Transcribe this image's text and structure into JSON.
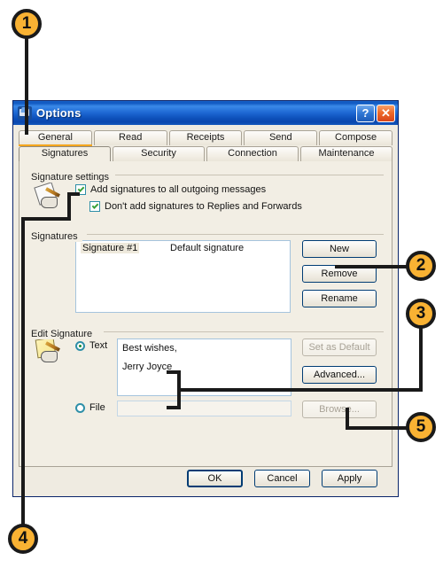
{
  "window": {
    "title": "Options",
    "icon": "mail-options-icon",
    "help_button": "?",
    "close_button": "✕"
  },
  "tabs": {
    "row1": [
      {
        "label": "General",
        "active": false,
        "underline": true
      },
      {
        "label": "Read",
        "active": false,
        "underline": false
      },
      {
        "label": "Receipts",
        "active": false,
        "underline": false
      },
      {
        "label": "Send",
        "active": false,
        "underline": false
      },
      {
        "label": "Compose",
        "active": false,
        "underline": false
      }
    ],
    "row2": [
      {
        "label": "Signatures",
        "active": true
      },
      {
        "label": "Security",
        "active": false
      },
      {
        "label": "Connection",
        "active": false
      },
      {
        "label": "Maintenance",
        "active": false
      }
    ]
  },
  "signature_settings": {
    "group_label": "Signature settings",
    "icon": "signature-pad-icon",
    "checkbox_add_all": {
      "label": "Add signatures to all outgoing messages",
      "checked": true
    },
    "checkbox_no_replies": {
      "label": "Don't add signatures to Replies and Forwards",
      "checked": true
    }
  },
  "signatures": {
    "group_label": "Signatures",
    "list": [
      {
        "name": "Signature #1",
        "status": "Default signature"
      }
    ],
    "buttons": {
      "new": "New",
      "remove": "Remove",
      "rename": "Rename"
    }
  },
  "edit_signature": {
    "group_label": "Edit Signature",
    "icon": "edit-signature-icon",
    "text_radio_label": "Text",
    "file_radio_label": "File",
    "text_selected": true,
    "file_selected": false,
    "text_value_line1": "Best wishes,",
    "text_value_line2": "Jerry Joyce",
    "file_value": "",
    "buttons": {
      "set_as_default": "Set as Default",
      "advanced": "Advanced...",
      "browse": "Browse..."
    }
  },
  "footer": {
    "ok": "OK",
    "cancel": "Cancel",
    "apply": "Apply"
  },
  "callouts": [
    {
      "number": "1",
      "target": "dialog-window"
    },
    {
      "number": "2",
      "target": "new-button"
    },
    {
      "number": "3",
      "target": "signature-text-area"
    },
    {
      "number": "4",
      "target": "signature-settings-checkboxes"
    },
    {
      "number": "5",
      "target": "advanced-button"
    }
  ],
  "colors": {
    "callout_fill": "#F9B233",
    "callout_border": "#1a1a1a",
    "titlebar_blue": "#1e69d4",
    "dialog_face": "#EFEBE1",
    "tab_underline": "#F4A51C"
  }
}
